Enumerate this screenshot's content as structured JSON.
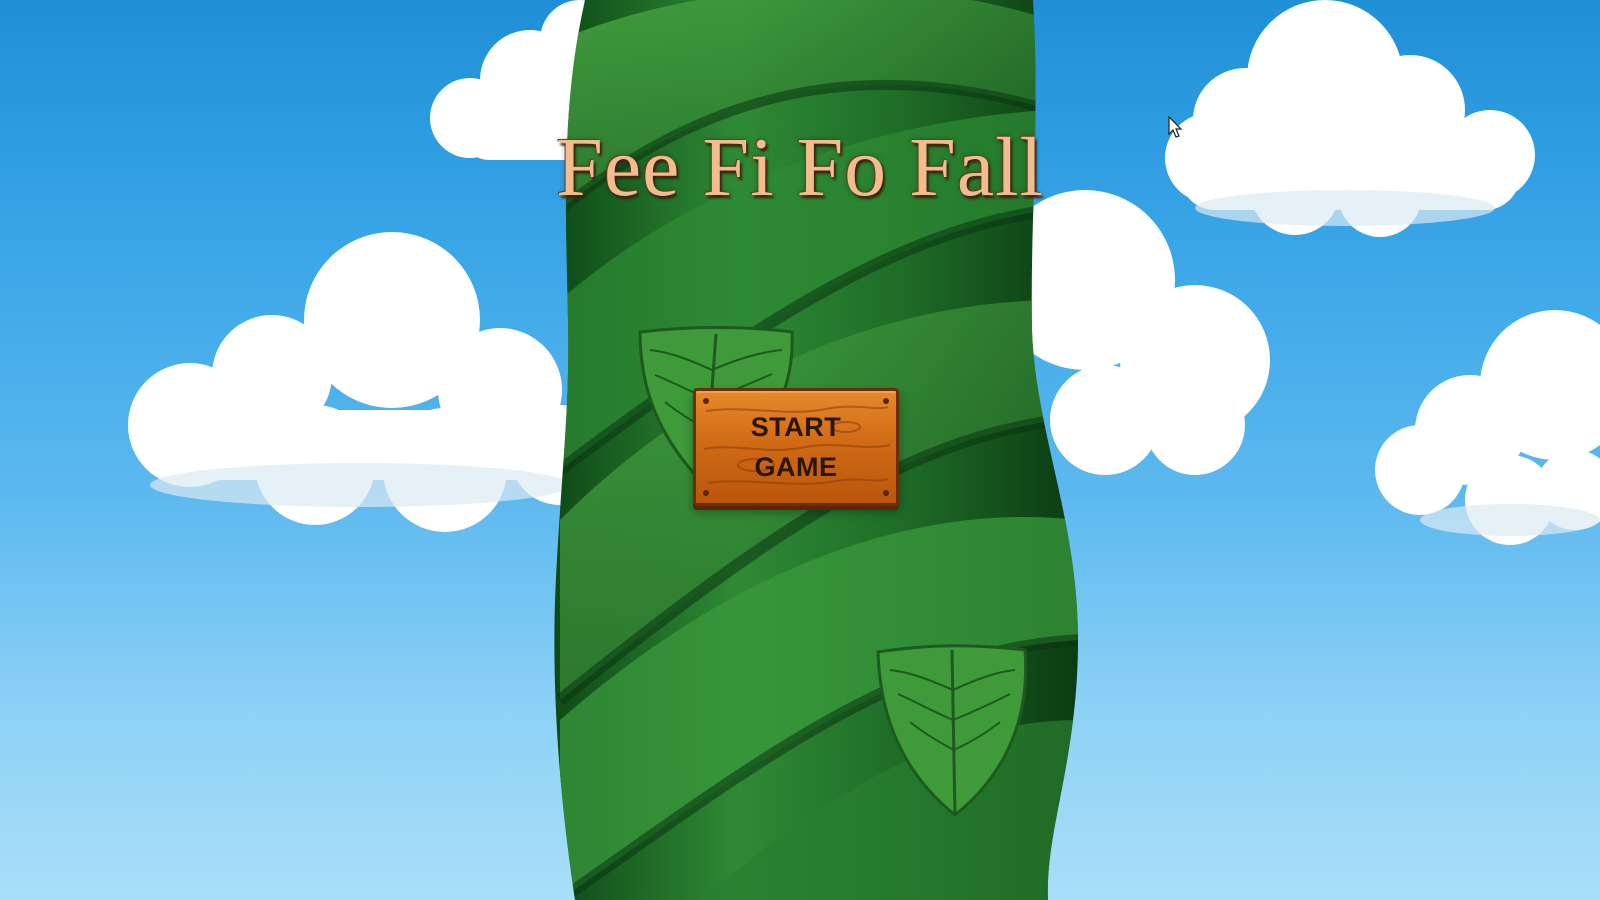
{
  "game": {
    "title": "Fee Fi Fo Fall",
    "start_button": {
      "line1": "START",
      "line2": "GAME"
    }
  },
  "colors": {
    "sky_top": "#1f8fd6",
    "sky_bottom": "#a9def8",
    "title_text": "#f3bc8e",
    "button_wood": "#d06b16",
    "beanstalk_dark": "#0f4a18",
    "beanstalk_light": "#3f9a3a"
  },
  "icons": {
    "cursor": "mouse-pointer-arrow-icon"
  }
}
